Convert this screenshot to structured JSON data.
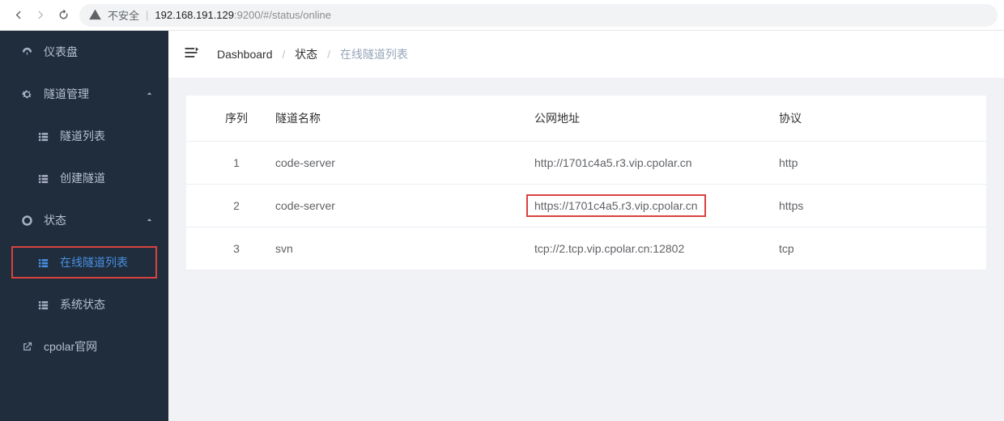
{
  "browser": {
    "insecure_label": "不安全",
    "url_host": "192.168.191.129",
    "url_rest": ":9200/#/status/online"
  },
  "sidebar": {
    "dashboard": "仪表盘",
    "tunnel_mgmt": "隧道管理",
    "tunnel_list": "隧道列表",
    "tunnel_create": "创建隧道",
    "status": "状态",
    "online_list": "在线隧道列表",
    "sys_status": "系统状态",
    "site": "cpolar官网"
  },
  "breadcrumb": {
    "a": "Dashboard",
    "b": "状态",
    "c": "在线隧道列表"
  },
  "table": {
    "headers": {
      "seq": "序列",
      "name": "隧道名称",
      "addr": "公网地址",
      "proto": "协议"
    },
    "rows": [
      {
        "seq": "1",
        "name": "code-server",
        "addr": "http://1701c4a5.r3.vip.cpolar.cn",
        "proto": "http",
        "hl": false
      },
      {
        "seq": "2",
        "name": "code-server",
        "addr": "https://1701c4a5.r3.vip.cpolar.cn",
        "proto": "https",
        "hl": true
      },
      {
        "seq": "3",
        "name": "svn",
        "addr": "tcp://2.tcp.vip.cpolar.cn:12802",
        "proto": "tcp",
        "hl": false
      }
    ]
  }
}
